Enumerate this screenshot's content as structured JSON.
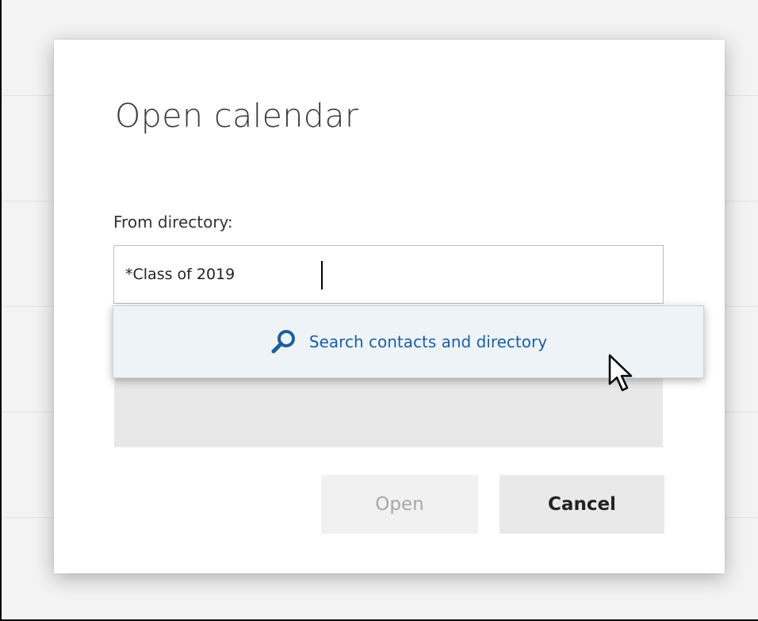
{
  "dialog": {
    "title": "Open calendar",
    "field_label": "From directory:",
    "input_value": "*Class of 2019",
    "suggestion": {
      "label": "Search contacts and directory",
      "icon": "search-icon"
    },
    "buttons": {
      "open_label": "Open",
      "cancel_label": "Cancel"
    }
  },
  "colors": {
    "accent": "#1b5f9c",
    "suggestion_bg": "#eef3f8",
    "button_bg": "#e9e9e9",
    "disabled_text": "#a7a7a7"
  }
}
